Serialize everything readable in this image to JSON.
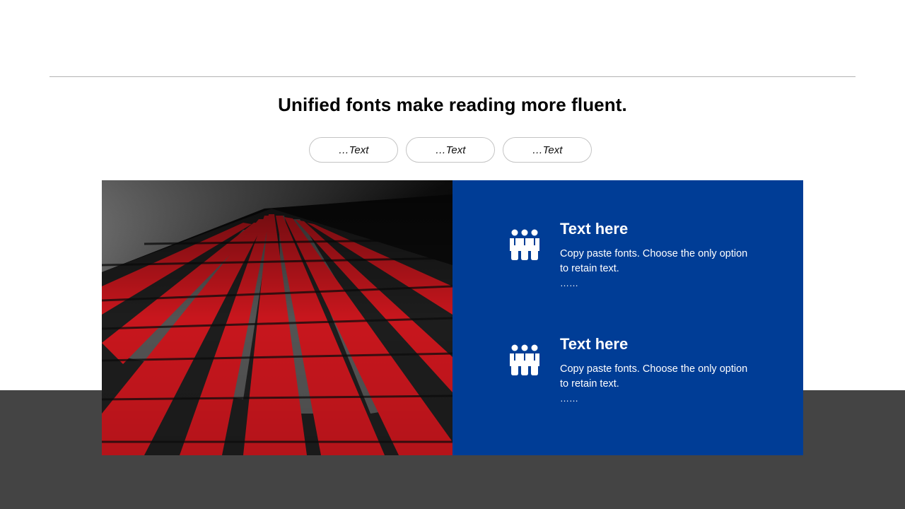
{
  "slide": {
    "title": "Unified fonts make reading more fluent."
  },
  "pills": [
    {
      "label": "…Text"
    },
    {
      "label": "…Text"
    },
    {
      "label": "…Text"
    }
  ],
  "features": [
    {
      "icon": "team-icon",
      "title": "Text here",
      "description": "Copy paste fonts. Choose the only option to retain text.",
      "more": "……"
    },
    {
      "icon": "team-icon",
      "title": "Text here",
      "description": "Copy paste fonts. Choose the only option to retain text.",
      "more": "……"
    }
  ],
  "colors": {
    "panel": "#003d96",
    "band": "#444444",
    "accent_red": "#c8161d"
  }
}
